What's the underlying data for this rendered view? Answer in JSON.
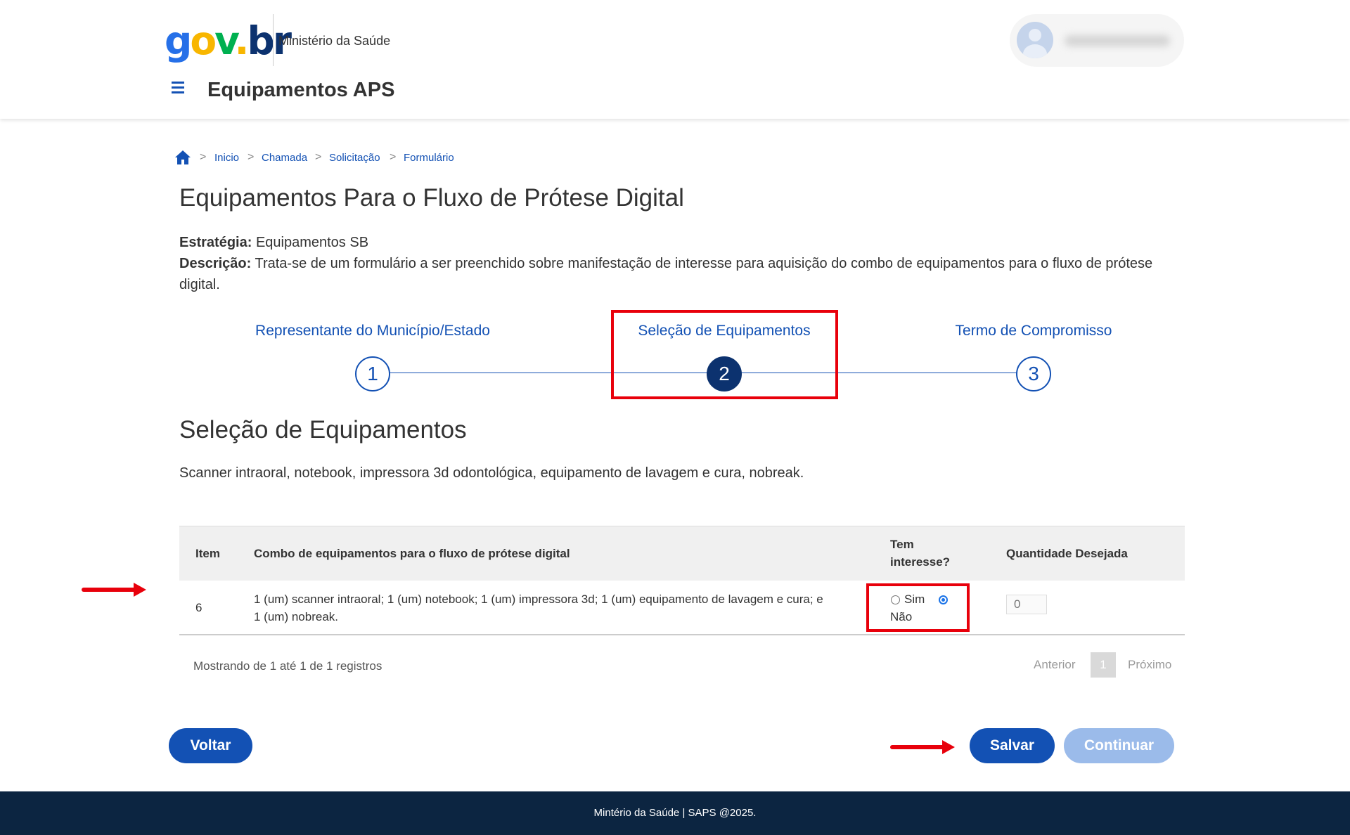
{
  "header": {
    "logo": {
      "g": "g",
      "o": "o",
      "v": "v",
      "dot": ".",
      "br": "br"
    },
    "org_name": "Ministério da Saúde",
    "app_title": "Equipamentos APS",
    "menu_icon": "hamburger-icon",
    "avatar_icon": "user-avatar-icon"
  },
  "breadcrumb": {
    "home_icon": "home-icon",
    "items": [
      "Inicio",
      "Chamada",
      "Solicitação",
      "Formulário"
    ],
    "separator": ">"
  },
  "page": {
    "title": "Equipamentos Para o Fluxo de Prótese Digital",
    "strategy_label": "Estratégia:",
    "strategy_value": "Equipamentos SB",
    "description_label": "Descrição:",
    "description_value": "Trata-se de um formulário a ser preenchido sobre manifestação de interesse para aquisição do combo de equipamentos para o fluxo de prótese digital."
  },
  "stepper": {
    "steps": [
      {
        "label": "Representante do Município/Estado",
        "number": "1",
        "active": false
      },
      {
        "label": "Seleção de Equipamentos",
        "number": "2",
        "active": true
      },
      {
        "label": "Termo de Compromisso",
        "number": "3",
        "active": false
      }
    ]
  },
  "section": {
    "title": "Seleção de Equipamentos",
    "description": "Scanner intraoral, notebook, impressora 3d odontológica, equipamento de lavagem e cura, nobreak."
  },
  "table": {
    "headers": {
      "item": "Item",
      "combo": "Combo de equipamentos para o fluxo de prótese digital",
      "interest_line1": "Tem",
      "interest_line2": "interesse?",
      "quantity": "Quantidade Desejada"
    },
    "rows": [
      {
        "item": "6",
        "combo_line1": "1 (um) scanner intraoral; 1 (um) notebook; 1 (um) impressora 3d; 1 (um) equipamento de lavagem e cura; e",
        "combo_line2": "1 (um) nobreak.",
        "option_yes": "Sim",
        "option_no": "Não",
        "selected": "Não",
        "quantity_placeholder": "0"
      }
    ],
    "info": "Mostrando de 1 até 1 de 1 registros",
    "pagination": {
      "previous": "Anterior",
      "page": "1",
      "next": "Próximo"
    }
  },
  "buttons": {
    "back": "Voltar",
    "save": "Salvar",
    "continue": "Continuar"
  },
  "footer": {
    "text": "Mintério da Saúde | SAPS @2025."
  },
  "colors": {
    "primary": "#1351b4",
    "dark_blue": "#0c326f",
    "disabled_button": "#9bbbea",
    "annotation_red": "#e8000b",
    "footer_bg": "#0c2541"
  }
}
